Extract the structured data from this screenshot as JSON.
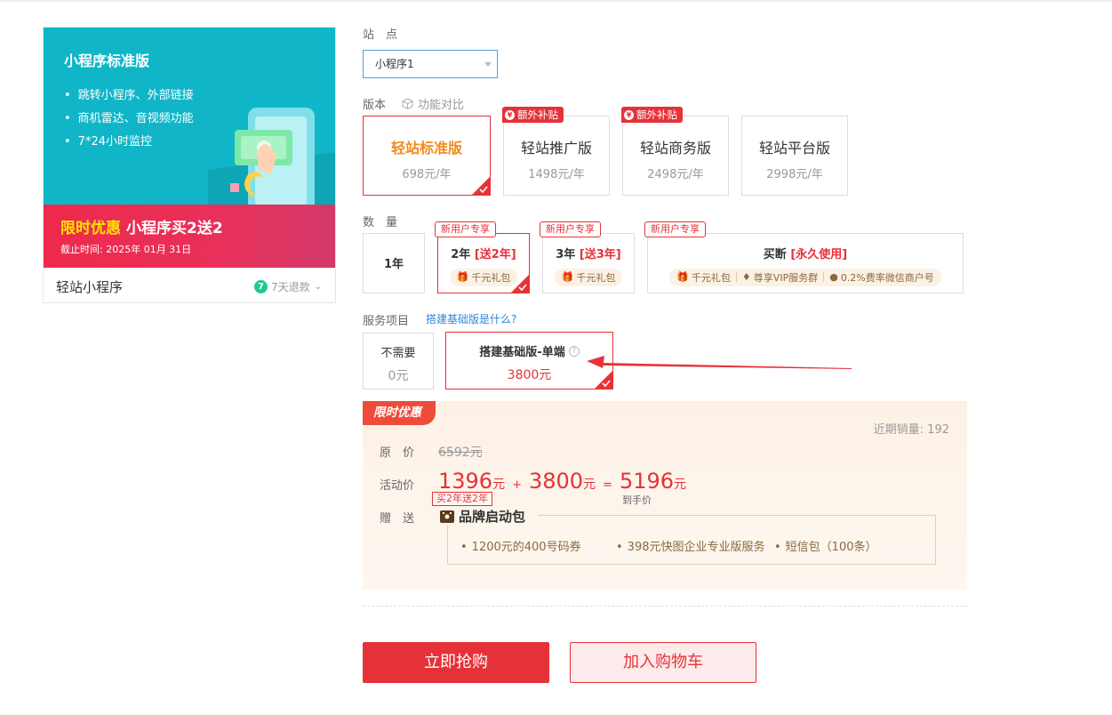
{
  "product": {
    "banner_title": "小程序标准版",
    "features": [
      "跳转小程序、外部链接",
      "商机雷达、音视频功能",
      "7*24小时监控"
    ],
    "promo_highlight": "限时优惠",
    "promo_text": "小程序买2送2",
    "deadline": "截止时间:  2025年 01月 31日",
    "name": "轻站小程序",
    "refund_badge": "7",
    "refund_label": "7天退款"
  },
  "site": {
    "label": "站　点",
    "selected": "小程序1"
  },
  "version": {
    "label": "版本",
    "compare": "功能对比",
    "options": [
      {
        "name": "轻站标准版",
        "price": "698元/年"
      },
      {
        "name": "轻站推广版",
        "price": "1498元/年",
        "tag": "额外补贴"
      },
      {
        "name": "轻站商务版",
        "price": "2498元/年",
        "tag": "额外补贴"
      },
      {
        "name": "轻站平台版",
        "price": "2998元/年"
      }
    ],
    "selected_index": 0
  },
  "quantity": {
    "label": "数　量",
    "new_user_tag": "新用户专享",
    "options": [
      {
        "main": "1年"
      },
      {
        "main": "2年",
        "bonus": "[送2年]",
        "gift": "千元礼包"
      },
      {
        "main": "3年",
        "bonus": "[送3年]",
        "gift": "千元礼包"
      },
      {
        "main": "买断",
        "bonus": "[永久使用]",
        "gifts": [
          "千元礼包",
          "尊享VIP服务群",
          "0.2%费率微信商户号"
        ]
      }
    ],
    "selected_index": 1
  },
  "service": {
    "label": "服务项目",
    "link": "搭建基础版是什么?",
    "options": [
      {
        "name": "不需要",
        "price": "0元"
      },
      {
        "name": "搭建基础版-单端",
        "price": "3800元"
      }
    ],
    "selected_index": 1
  },
  "promo": {
    "tag": "限时优惠",
    "sales": "近期销量: 192",
    "orig_label": "原　价",
    "orig_price": "6592元",
    "act_label": "活动价",
    "act_price": "1396",
    "act_unit": "元",
    "plus": "+",
    "service_price": "3800",
    "service_unit": "元",
    "equals": "=",
    "final_price": "5196",
    "final_unit": "元",
    "final_sub": "到手价",
    "buy_tag": "买2年送2年",
    "gift_label": "赠　送",
    "package_title": "品牌启动包",
    "package_items": [
      "1200元的400号码券",
      "398元快图企业专业版服务",
      "短信包（100条）"
    ]
  },
  "actions": {
    "buy": "立即抢购",
    "cart": "加入购物车"
  },
  "colors": {
    "accent": "#e53238",
    "banner": "#10b6c8",
    "selected_version": "#f08c1a"
  }
}
